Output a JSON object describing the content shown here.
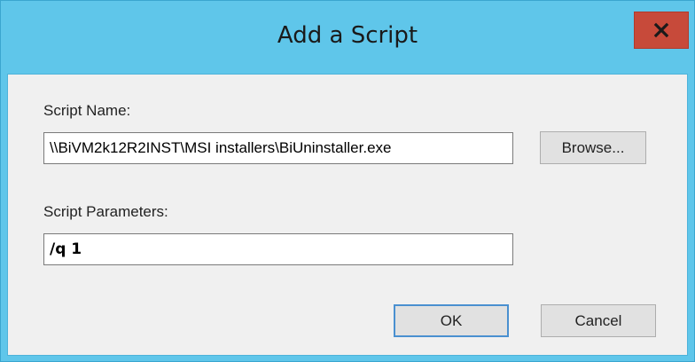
{
  "window": {
    "title": "Add a Script"
  },
  "icons": {
    "close": "close-icon"
  },
  "form": {
    "script_name_label": "Script Name:",
    "script_name_value": "\\\\BiVM2k12R2INST\\MSI installers\\BiUninstaller.exe",
    "script_parameters_label": "Script Parameters:",
    "script_parameters_value": "/q 1"
  },
  "buttons": {
    "browse": "Browse...",
    "ok": "OK",
    "cancel": "Cancel"
  },
  "colors": {
    "title_bar": "#5fc6ea",
    "close_button": "#c74a3a",
    "client_background": "#f0f0f0"
  }
}
